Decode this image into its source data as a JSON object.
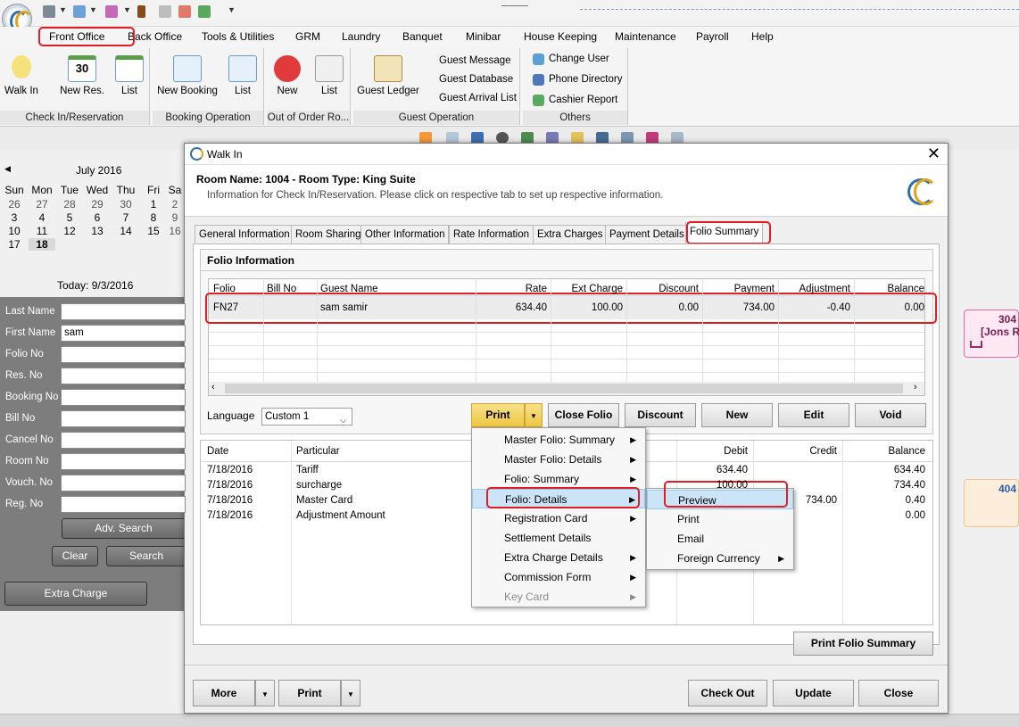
{
  "quickbar": {
    "icons": [
      "database-icon",
      "chart-icon",
      "clipboard-icon",
      "door-icon",
      "trash-icon",
      "report-icon",
      "check-icon"
    ]
  },
  "menu": [
    "Front Office",
    "Back Office",
    "Tools & Utilities",
    "GRM",
    "Laundry",
    "Banquet",
    "Minibar",
    "House Keeping",
    "Maintenance",
    "Payroll",
    "Help"
  ],
  "ribbon": {
    "checkin": {
      "label": "Check In/Reservation",
      "walkin": "Walk In",
      "newres": "New Res.",
      "list": "List",
      "calnum": "30"
    },
    "booking": {
      "label": "Booking Operation",
      "newbooking": "New Booking",
      "list": "List"
    },
    "ooo": {
      "label": "Out of Order Ro...",
      "new": "New",
      "list": "List"
    },
    "guestop": {
      "label": "Guest Operation",
      "ledger": "Guest Ledger",
      "message": "Guest Message",
      "database": "Guest Database",
      "arrival": "Guest Arrival List"
    },
    "others": {
      "label": "Others",
      "changeuser": "Change User",
      "phone": "Phone Directory",
      "cashier": "Cashier Report"
    }
  },
  "calendar": {
    "month": "July 2016",
    "days": [
      "Sun",
      "Mon",
      "Tue",
      "Wed",
      "Thu",
      "Fri",
      "Sa"
    ],
    "rows": [
      [
        "26",
        "27",
        "28",
        "29",
        "30",
        "1",
        "2"
      ],
      [
        "3",
        "4",
        "5",
        "6",
        "7",
        "8",
        "9"
      ],
      [
        "10",
        "11",
        "12",
        "13",
        "14",
        "15",
        "16"
      ],
      [
        "17",
        "18",
        "",
        "",
        "",
        "",
        ""
      ]
    ],
    "today": "Today: 9/3/2016"
  },
  "search": {
    "fields": [
      {
        "label": "Last Name",
        "value": ""
      },
      {
        "label": "First Name",
        "value": "sam"
      },
      {
        "label": "Folio No",
        "value": ""
      },
      {
        "label": "Res. No",
        "value": ""
      },
      {
        "label": "Booking No",
        "value": ""
      },
      {
        "label": "Bill No",
        "value": ""
      },
      {
        "label": "Cancel No",
        "value": ""
      },
      {
        "label": "Room No",
        "value": ""
      },
      {
        "label": "Vouch. No",
        "value": ""
      },
      {
        "label": "Reg. No",
        "value": ""
      }
    ],
    "adv": "Adv. Search",
    "clear": "Clear",
    "search": "Search",
    "extra": "Extra Charge"
  },
  "bg": {
    "card1_num": "304",
    "card1_name": "[Jons R",
    "card2_num": "404"
  },
  "dialog": {
    "title": "Walk In",
    "room": "Room Name: 1004 - Room Type: King Suite",
    "info": "Information for Check In/Reservation. Please click on respective tab to set up respective information.",
    "tabs": [
      "General Information",
      "Room Sharing",
      "Other Information",
      "Rate Information",
      "Extra Charges",
      "Payment Details",
      "Folio Summary"
    ],
    "folio_title": "Folio Information",
    "folio_headers": [
      "Folio",
      "Bill No",
      "Guest Name",
      "Rate",
      "Ext Charge",
      "Discount",
      "Payment",
      "Adjustment",
      "Balance"
    ],
    "folio_row": [
      "FN27",
      "",
      "sam samir",
      "634.40",
      "100.00",
      "0.00",
      "734.00",
      "-0.40",
      "0.00"
    ],
    "language_label": "Language",
    "language_value": "Custom 1",
    "buttons": {
      "print": "Print",
      "close_folio": "Close Folio",
      "discount": "Discount",
      "new": "New",
      "edit": "Edit",
      "void": "Void",
      "print_summary": "Print Folio Summary",
      "more": "More",
      "print2": "Print",
      "checkout": "Check Out",
      "update": "Update",
      "close": "Close"
    },
    "detail_headers": [
      "Date",
      "Particular",
      "Debit",
      "Credit",
      "Balance"
    ],
    "detail_rows": [
      {
        "date": "7/18/2016",
        "particular": "Tariff",
        "debit": "634.40",
        "credit": "",
        "balance": "634.40"
      },
      {
        "date": "7/18/2016",
        "particular": "surcharge",
        "debit": "100.00",
        "credit": "",
        "balance": "734.40"
      },
      {
        "date": "7/18/2016",
        "particular": "Master Card",
        "debit": "",
        "credit": "734.00",
        "balance": "0.40"
      },
      {
        "date": "7/18/2016",
        "particular": "Adjustment Amount",
        "debit": "",
        "credit": "",
        "balance": "0.00"
      }
    ]
  },
  "printmenu": [
    "Master Folio: Summary",
    "Master Folio: Details",
    "Folio: Summary",
    "Folio: Details",
    "Registration Card",
    "Settlement Details",
    "Extra Charge Details",
    "Commission Form",
    "Key Card"
  ],
  "submenu": [
    "Preview",
    "Print",
    "Email",
    "Foreign Currency"
  ]
}
